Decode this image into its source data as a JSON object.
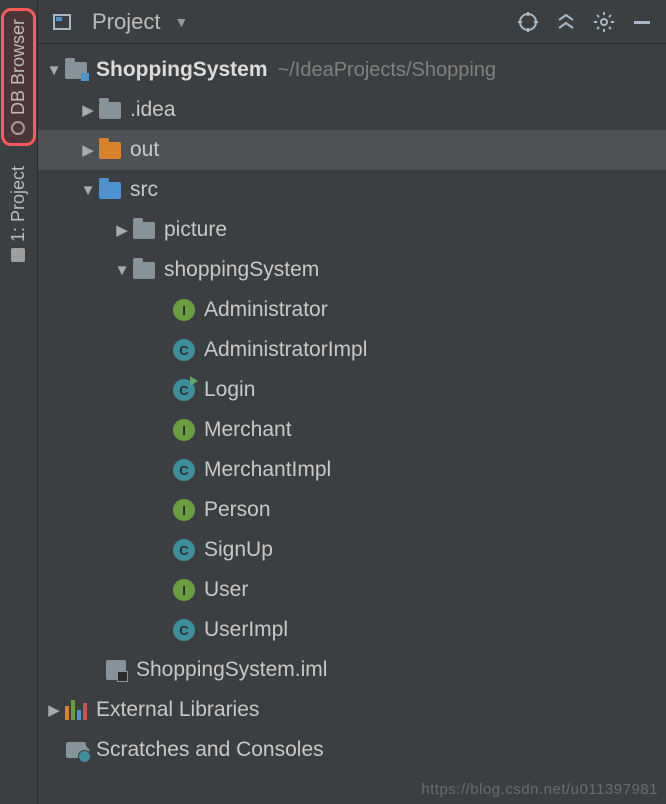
{
  "left_tabs": [
    {
      "label": "DB Browser",
      "highlighted": true
    },
    {
      "label": "1: Project",
      "highlighted": false
    }
  ],
  "toolbar": {
    "title": "Project"
  },
  "tree": {
    "root": {
      "name": "ShoppingSystem",
      "path": "~/IdeaProjects/Shopping",
      "children": [
        {
          "name": ".idea",
          "type": "folder-grey",
          "expanded": false
        },
        {
          "name": "out",
          "type": "folder-orange",
          "expanded": false,
          "selected": true
        },
        {
          "name": "src",
          "type": "folder-blue",
          "expanded": true,
          "children": [
            {
              "name": "picture",
              "type": "folder-grey",
              "expanded": false
            },
            {
              "name": "shoppingSystem",
              "type": "folder-grey",
              "expanded": true,
              "children": [
                {
                  "name": "Administrator",
                  "type": "interface"
                },
                {
                  "name": "AdministratorImpl",
                  "type": "class"
                },
                {
                  "name": "Login",
                  "type": "class-run"
                },
                {
                  "name": "Merchant",
                  "type": "interface"
                },
                {
                  "name": "MerchantImpl",
                  "type": "class"
                },
                {
                  "name": "Person",
                  "type": "interface"
                },
                {
                  "name": "SignUp",
                  "type": "class"
                },
                {
                  "name": "User",
                  "type": "interface"
                },
                {
                  "name": "UserImpl",
                  "type": "class"
                }
              ]
            }
          ]
        },
        {
          "name": "ShoppingSystem.iml",
          "type": "iml"
        }
      ]
    },
    "extras": [
      {
        "name": "External Libraries",
        "type": "libs",
        "expanded": false
      },
      {
        "name": "Scratches and Consoles",
        "type": "scratch"
      }
    ]
  },
  "watermark": "https://blog.csdn.net/u011397981"
}
